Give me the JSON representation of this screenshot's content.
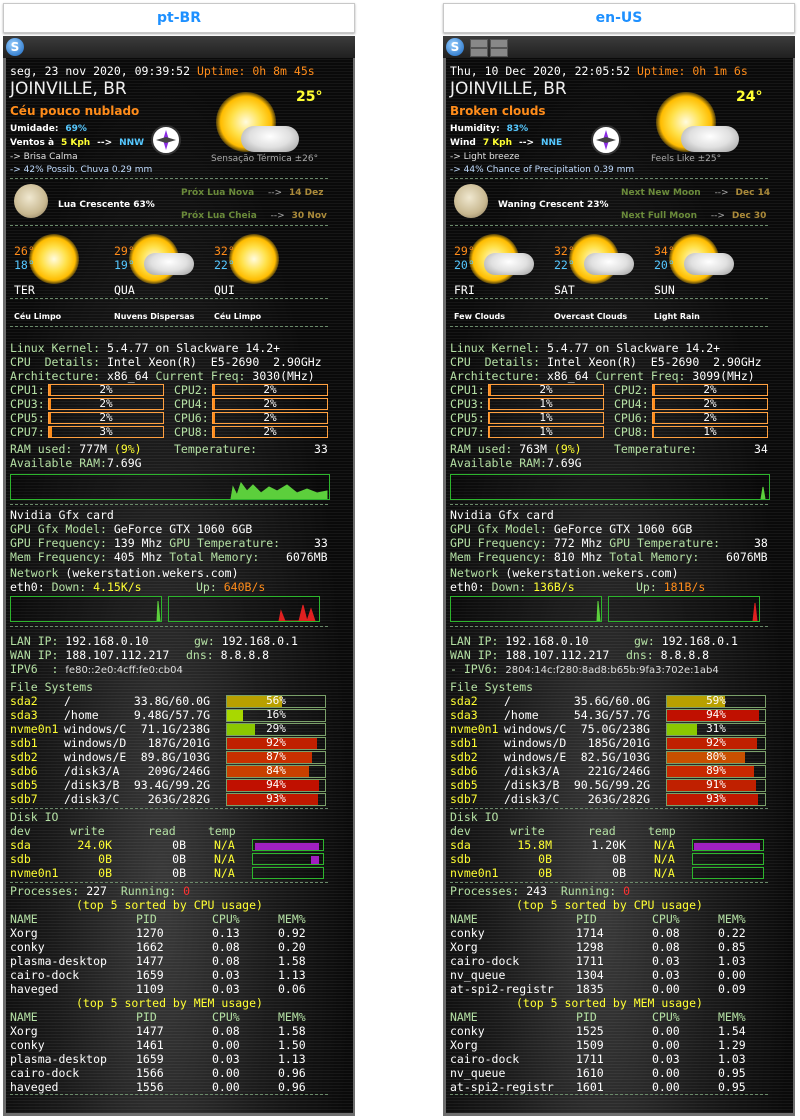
{
  "panels": [
    {
      "lang": "pt-BR",
      "datetime": "seg, 23 nov 2020, 09:39:52",
      "uptime_label": "Uptime:",
      "uptime": "0h 8m 45s",
      "city": "JOINVILLE, BR",
      "condition": "Céu pouco nublado",
      "temp_now": "25°",
      "humidity_label": "Umidade:",
      "humidity": "69%",
      "wind_label": "Ventos à",
      "wind_speed": "5 Kph",
      "wind_arrow": "-->",
      "wind_dir": "NNW",
      "wind_desc": "-> Brisa Calma",
      "precip": "-> 42% Possib. Chuva 0.29 mm",
      "feels_like": "Sensação Térmica ±26°",
      "moon_phase": "Lua Crescente 63%",
      "next_new_moon_label": "Próx Lua Nova",
      "next_new_moon": "14 Dez",
      "next_full_moon_label": "Próx Lua Cheia",
      "next_full_moon": "30 Nov",
      "forecast": [
        {
          "hi": "26°",
          "lo": "18°",
          "day": "TER",
          "desc": "Céu Limpo"
        },
        {
          "hi": "29°",
          "lo": "19°",
          "day": "QUA",
          "desc": "Nuvens Dispersas"
        },
        {
          "hi": "32°",
          "lo": "22°",
          "day": "QUI",
          "desc": "Céu Limpo"
        }
      ],
      "kernel_label": "Linux Kernel:",
      "kernel": "5.4.77 on Slackware 14.2+",
      "cpu_label": "CPU  Details:",
      "cpu": "Intel Xeon(R)  E5-2690  2.90GHz",
      "arch_label": "Architecture:",
      "arch": "x86_64",
      "freq_label": "Current Freq:",
      "freq": "3030(MHz)",
      "cpus": [
        {
          "label": "CPU1:",
          "value": "2%",
          "frac": 0.02
        },
        {
          "label": "CPU2:",
          "value": "2%",
          "frac": 0.02
        },
        {
          "label": "CPU3:",
          "value": "2%",
          "frac": 0.02
        },
        {
          "label": "CPU4:",
          "value": "2%",
          "frac": 0.02
        },
        {
          "label": "CPU5:",
          "value": "2%",
          "frac": 0.02
        },
        {
          "label": "CPU6:",
          "value": "2%",
          "frac": 0.02
        },
        {
          "label": "CPU7:",
          "value": "3%",
          "frac": 0.03
        },
        {
          "label": "CPU8:",
          "value": "2%",
          "frac": 0.02
        }
      ],
      "ram_label": "RAM used:",
      "ram": "777M",
      "ram_pct": "(9%)",
      "temp_label": "Temperature:",
      "temp": "33",
      "avail_label": "Available RAM:",
      "avail": "7.69G",
      "gfx_title": "Nvidia Gfx card",
      "gpu_model_label": "GPU Gfx Model:",
      "gpu_model": "GeForce GTX 1060 6GB",
      "gpu_freq_label": "GPU Frequency:",
      "gpu_freq": "139 Mhz",
      "gpu_temp_label": "GPU Temperature:",
      "gpu_temp": "33",
      "mem_freq_label": "Mem Frequency:",
      "mem_freq": "405 Mhz",
      "total_mem_label": "Total Memory:",
      "total_mem": "6076MB",
      "network_title": "Network",
      "hostname": "(wekerstation.wekers.com)",
      "iface": "eth0:",
      "down_label": "Down:",
      "down": "4.15K/s",
      "up_label": "Up:",
      "up": "640B/s",
      "lan_label": "LAN IP:",
      "lan": "192.168.0.10",
      "gw_label": "gw:",
      "gw": "192.168.0.1",
      "wan_label": "WAN IP:",
      "wan": "188.107.112.217",
      "dns_label": "dns:",
      "dns": "8.8.8.8",
      "ipv6_label": "IPV6  :",
      "ipv6": "fe80::2e0:4cff:fe0:cb04",
      "fs_title": "File Systems",
      "fs": [
        {
          "dev": "sda2",
          "mount": "/",
          "usage": "33.8G/60.0G",
          "pct": "56%",
          "frac": 0.56,
          "color": "#b8a000"
        },
        {
          "dev": "sda3",
          "mount": "/home",
          "usage": "9.48G/57.7G",
          "pct": "16%",
          "frac": 0.16,
          "color": "#a8d800"
        },
        {
          "dev": "nvme0n1",
          "mount": "windows/C",
          "usage": "71.1G/238G",
          "pct": "29%",
          "frac": 0.29,
          "color": "#8bc800"
        },
        {
          "dev": "sdb1",
          "mount": "windows/D",
          "usage": "187G/201G",
          "pct": "92%",
          "frac": 0.92,
          "color": "#c02000"
        },
        {
          "dev": "sdb2",
          "mount": "windows/E",
          "usage": "89.8G/103G",
          "pct": "87%",
          "frac": 0.87,
          "color": "#c83000"
        },
        {
          "dev": "sdb6",
          "mount": "/disk3/A",
          "usage": "209G/246G",
          "pct": "84%",
          "frac": 0.84,
          "color": "#c84000"
        },
        {
          "dev": "sdb5",
          "mount": "/disk3/B",
          "usage": "93.4G/99.2G",
          "pct": "94%",
          "frac": 0.94,
          "color": "#c01000"
        },
        {
          "dev": "sdb7",
          "mount": "/disk3/C",
          "usage": "263G/282G",
          "pct": "93%",
          "frac": 0.93,
          "color": "#c01800"
        }
      ],
      "disk_title": "Disk IO",
      "disk_head": {
        "dev": "dev",
        "write": "write",
        "read": "read",
        "temp": "temp"
      },
      "disks": [
        {
          "dev": "sda",
          "write": "24.0K",
          "read": "0B",
          "temp": "N/A"
        },
        {
          "dev": "sdb",
          "write": "0B",
          "read": "0B",
          "temp": "N/A"
        },
        {
          "dev": "nvme0n1",
          "write": "0B",
          "read": "0B",
          "temp": "N/A"
        }
      ],
      "proc_label": "Processes:",
      "proc": "227",
      "running_label": "Running:",
      "running": "0",
      "top_cpu_title": "(top 5 sorted by CPU usage)",
      "top_mem_title": "(top 5 sorted by MEM usage)",
      "cols": {
        "name": "NAME",
        "pid": "PID",
        "cpu": "CPU%",
        "mem": "MEM%"
      },
      "top_cpu": [
        {
          "name": "Xorg",
          "pid": "1270",
          "cpu": "0.13",
          "mem": "0.92"
        },
        {
          "name": "conky",
          "pid": "1662",
          "cpu": "0.08",
          "mem": "0.20"
        },
        {
          "name": "plasma-desktop",
          "pid": "1477",
          "cpu": "0.08",
          "mem": "1.58"
        },
        {
          "name": "cairo-dock",
          "pid": "1659",
          "cpu": "0.03",
          "mem": "1.13"
        },
        {
          "name": "haveged",
          "pid": "1109",
          "cpu": "0.03",
          "mem": "0.06"
        }
      ],
      "top_mem": [
        {
          "name": "Xorg",
          "pid": "1477",
          "cpu": "0.08",
          "mem": "1.58"
        },
        {
          "name": "conky",
          "pid": "1461",
          "cpu": "0.00",
          "mem": "1.50"
        },
        {
          "name": "plasma-desktop",
          "pid": "1659",
          "cpu": "0.03",
          "mem": "1.13"
        },
        {
          "name": "cairo-dock",
          "pid": "1566",
          "cpu": "0.00",
          "mem": "0.96"
        },
        {
          "name": "haveged",
          "pid": "1556",
          "cpu": "0.00",
          "mem": "0.96"
        }
      ]
    },
    {
      "lang": "en-US",
      "datetime": "Thu, 10 Dec 2020, 22:05:52",
      "uptime_label": "Uptime:",
      "uptime": "0h 1m 6s",
      "city": "JOINVILLE, BR",
      "condition": "Broken clouds",
      "temp_now": "24°",
      "humidity_label": "Humidity:",
      "humidity": "83%",
      "wind_label": "Wind",
      "wind_speed": "7 Kph",
      "wind_arrow": "-->",
      "wind_dir": "NNE",
      "wind_desc": "-> Light breeze",
      "precip": "-> 44% Chance of Precipitation 0.39 mm",
      "feels_like": "Feels Like ±25°",
      "moon_phase": "Waning Crescent 23%",
      "next_new_moon_label": "Next New Moon",
      "next_new_moon": "Dec 14",
      "next_full_moon_label": "Next Full Moon",
      "next_full_moon": "Dec 30",
      "forecast": [
        {
          "hi": "29°",
          "lo": "20°",
          "day": "FRI",
          "desc": "Few Clouds"
        },
        {
          "hi": "32°",
          "lo": "22°",
          "day": "SAT",
          "desc": "Overcast Clouds"
        },
        {
          "hi": "34°",
          "lo": "20°",
          "day": "SUN",
          "desc": "Light Rain"
        }
      ],
      "kernel_label": "Linux Kernel:",
      "kernel": "5.4.77 on Slackware 14.2+",
      "cpu_label": "CPU  Details:",
      "cpu": "Intel Xeon(R)  E5-2690  2.90GHz",
      "arch_label": "Architecture:",
      "arch": "x86_64",
      "freq_label": "Current Freq:",
      "freq": "3099(MHz)",
      "cpus": [
        {
          "label": "CPU1:",
          "value": "2%",
          "frac": 0.02
        },
        {
          "label": "CPU2:",
          "value": "2%",
          "frac": 0.02
        },
        {
          "label": "CPU3:",
          "value": "1%",
          "frac": 0.01
        },
        {
          "label": "CPU4:",
          "value": "2%",
          "frac": 0.02
        },
        {
          "label": "CPU5:",
          "value": "1%",
          "frac": 0.01
        },
        {
          "label": "CPU6:",
          "value": "2%",
          "frac": 0.02
        },
        {
          "label": "CPU7:",
          "value": "1%",
          "frac": 0.01
        },
        {
          "label": "CPU8:",
          "value": "1%",
          "frac": 0.01
        }
      ],
      "ram_label": "RAM used:",
      "ram": "763M",
      "ram_pct": "(9%)",
      "temp_label": "Temperature:",
      "temp": "34",
      "avail_label": "Available RAM:",
      "avail": "7.69G",
      "gfx_title": "Nvidia Gfx card",
      "gpu_model_label": "GPU Gfx Model:",
      "gpu_model": "GeForce GTX 1060 6GB",
      "gpu_freq_label": "GPU Frequency:",
      "gpu_freq": "772 Mhz",
      "gpu_temp_label": "GPU Temperature:",
      "gpu_temp": "38",
      "mem_freq_label": "Mem Frequency:",
      "mem_freq": "810 Mhz",
      "total_mem_label": "Total Memory:",
      "total_mem": "6076MB",
      "network_title": "Network",
      "hostname": "(wekerstation.wekers.com)",
      "iface": "eth0:",
      "down_label": "Down:",
      "down": "136B/s",
      "up_label": "Up:",
      "up": "181B/s",
      "lan_label": "LAN IP:",
      "lan": "192.168.0.10",
      "gw_label": "gw:",
      "gw": "192.168.0.1",
      "wan_label": "WAN IP:",
      "wan": "188.107.112.217",
      "dns_label": "dns:",
      "dns": "8.8.8.8",
      "ipv6_label": "- IPV6:",
      "ipv6": "2804:14c:f280:8ad8:b65b:9fa3:702e:1ab4",
      "fs_title": "File Systems",
      "fs": [
        {
          "dev": "sda2",
          "mount": "/",
          "usage": "35.6G/60.0G",
          "pct": "59%",
          "frac": 0.59,
          "color": "#b8a000"
        },
        {
          "dev": "sda3",
          "mount": "/home",
          "usage": "54.3G/57.7G",
          "pct": "94%",
          "frac": 0.94,
          "color": "#c01000"
        },
        {
          "dev": "nvme0n1",
          "mount": "windows/C",
          "usage": "75.0G/238G",
          "pct": "31%",
          "frac": 0.31,
          "color": "#8bc800"
        },
        {
          "dev": "sdb1",
          "mount": "windows/D",
          "usage": "185G/201G",
          "pct": "92%",
          "frac": 0.92,
          "color": "#c02000"
        },
        {
          "dev": "sdb2",
          "mount": "windows/E",
          "usage": "82.5G/103G",
          "pct": "80%",
          "frac": 0.8,
          "color": "#c85000"
        },
        {
          "dev": "sdb6",
          "mount": "/disk3/A",
          "usage": "221G/246G",
          "pct": "89%",
          "frac": 0.89,
          "color": "#c82800"
        },
        {
          "dev": "sdb5",
          "mount": "/disk3/B",
          "usage": "90.5G/99.2G",
          "pct": "91%",
          "frac": 0.91,
          "color": "#c02000"
        },
        {
          "dev": "sdb7",
          "mount": "/disk3/C",
          "usage": "263G/282G",
          "pct": "93%",
          "frac": 0.93,
          "color": "#c01800"
        }
      ],
      "disk_title": "Disk IO",
      "disk_head": {
        "dev": "dev",
        "write": "write",
        "read": "read",
        "temp": "temp"
      },
      "disks": [
        {
          "dev": "sda",
          "write": "15.8M",
          "read": "1.20K",
          "temp": "N/A"
        },
        {
          "dev": "sdb",
          "write": "0B",
          "read": "0B",
          "temp": "N/A"
        },
        {
          "dev": "nvme0n1",
          "write": "0B",
          "read": "0B",
          "temp": "N/A"
        }
      ],
      "proc_label": "Processes:",
      "proc": "243",
      "running_label": "Running:",
      "running": "0",
      "top_cpu_title": "(top 5 sorted by CPU usage)",
      "top_mem_title": "(top 5 sorted by MEM usage)",
      "cols": {
        "name": "NAME",
        "pid": "PID",
        "cpu": "CPU%",
        "mem": "MEM%"
      },
      "top_cpu": [
        {
          "name": "conky",
          "pid": "1714",
          "cpu": "0.08",
          "mem": "0.22"
        },
        {
          "name": "Xorg",
          "pid": "1298",
          "cpu": "0.08",
          "mem": "0.85"
        },
        {
          "name": "cairo-dock",
          "pid": "1711",
          "cpu": "0.03",
          "mem": "1.03"
        },
        {
          "name": "nv_queue",
          "pid": "1304",
          "cpu": "0.03",
          "mem": "0.00"
        },
        {
          "name": "at-spi2-registr",
          "pid": "1835",
          "cpu": "0.00",
          "mem": "0.09"
        }
      ],
      "top_mem": [
        {
          "name": "conky",
          "pid": "1525",
          "cpu": "0.00",
          "mem": "1.54"
        },
        {
          "name": "Xorg",
          "pid": "1509",
          "cpu": "0.00",
          "mem": "1.29"
        },
        {
          "name": "cairo-dock",
          "pid": "1711",
          "cpu": "0.03",
          "mem": "1.03"
        },
        {
          "name": "nv_queue",
          "pid": "1610",
          "cpu": "0.00",
          "mem": "0.95"
        },
        {
          "name": "at-spi2-registr",
          "pid": "1601",
          "cpu": "0.00",
          "mem": "0.95"
        }
      ]
    }
  ]
}
